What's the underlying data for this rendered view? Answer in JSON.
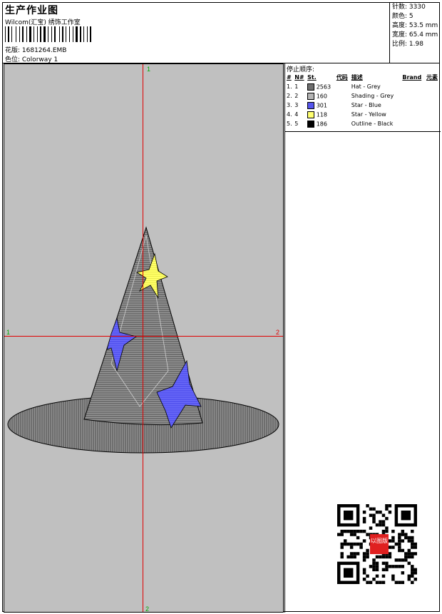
{
  "header": {
    "title": "生产作业图",
    "studio": "Wilcom(汇宝) 绣饰工作室",
    "design_line": "花版:  1681264.EMB",
    "colorway_line": "色位:  Colorway 1"
  },
  "stats": {
    "stitches": "针数: 3330",
    "colors": "颜色: 5",
    "height": "高度: 53.5 mm",
    "width": "宽度: 65.4 mm",
    "ratio": "比例: 1.98"
  },
  "canvas": {
    "axis_top": "1",
    "axis_bottom": "2",
    "axis_left": "1",
    "axis_right": "2"
  },
  "stop_sequence": {
    "title": "停止顺序:",
    "headers": [
      "#",
      "N#",
      "St.",
      "代码",
      "描述",
      "Brand",
      "元素"
    ],
    "rows": [
      {
        "num": "1.",
        "n": "1",
        "st": "2563",
        "desc": "Hat - Grey",
        "color": "#6e6e6e"
      },
      {
        "num": "2.",
        "n": "2",
        "st": "160",
        "desc": "Shading - Grey",
        "color": "#b4b4b4"
      },
      {
        "num": "3.",
        "n": "3",
        "st": "301",
        "desc": "Star - Blue",
        "color": "#5555ee"
      },
      {
        "num": "4.",
        "n": "4",
        "st": "118",
        "desc": "Star - Yellow",
        "color": "#ffff70"
      },
      {
        "num": "5.",
        "n": "5",
        "st": "186",
        "desc": "Outline - Black",
        "color": "#000000"
      }
    ]
  },
  "qr": {
    "stamp_text": "以图版"
  }
}
